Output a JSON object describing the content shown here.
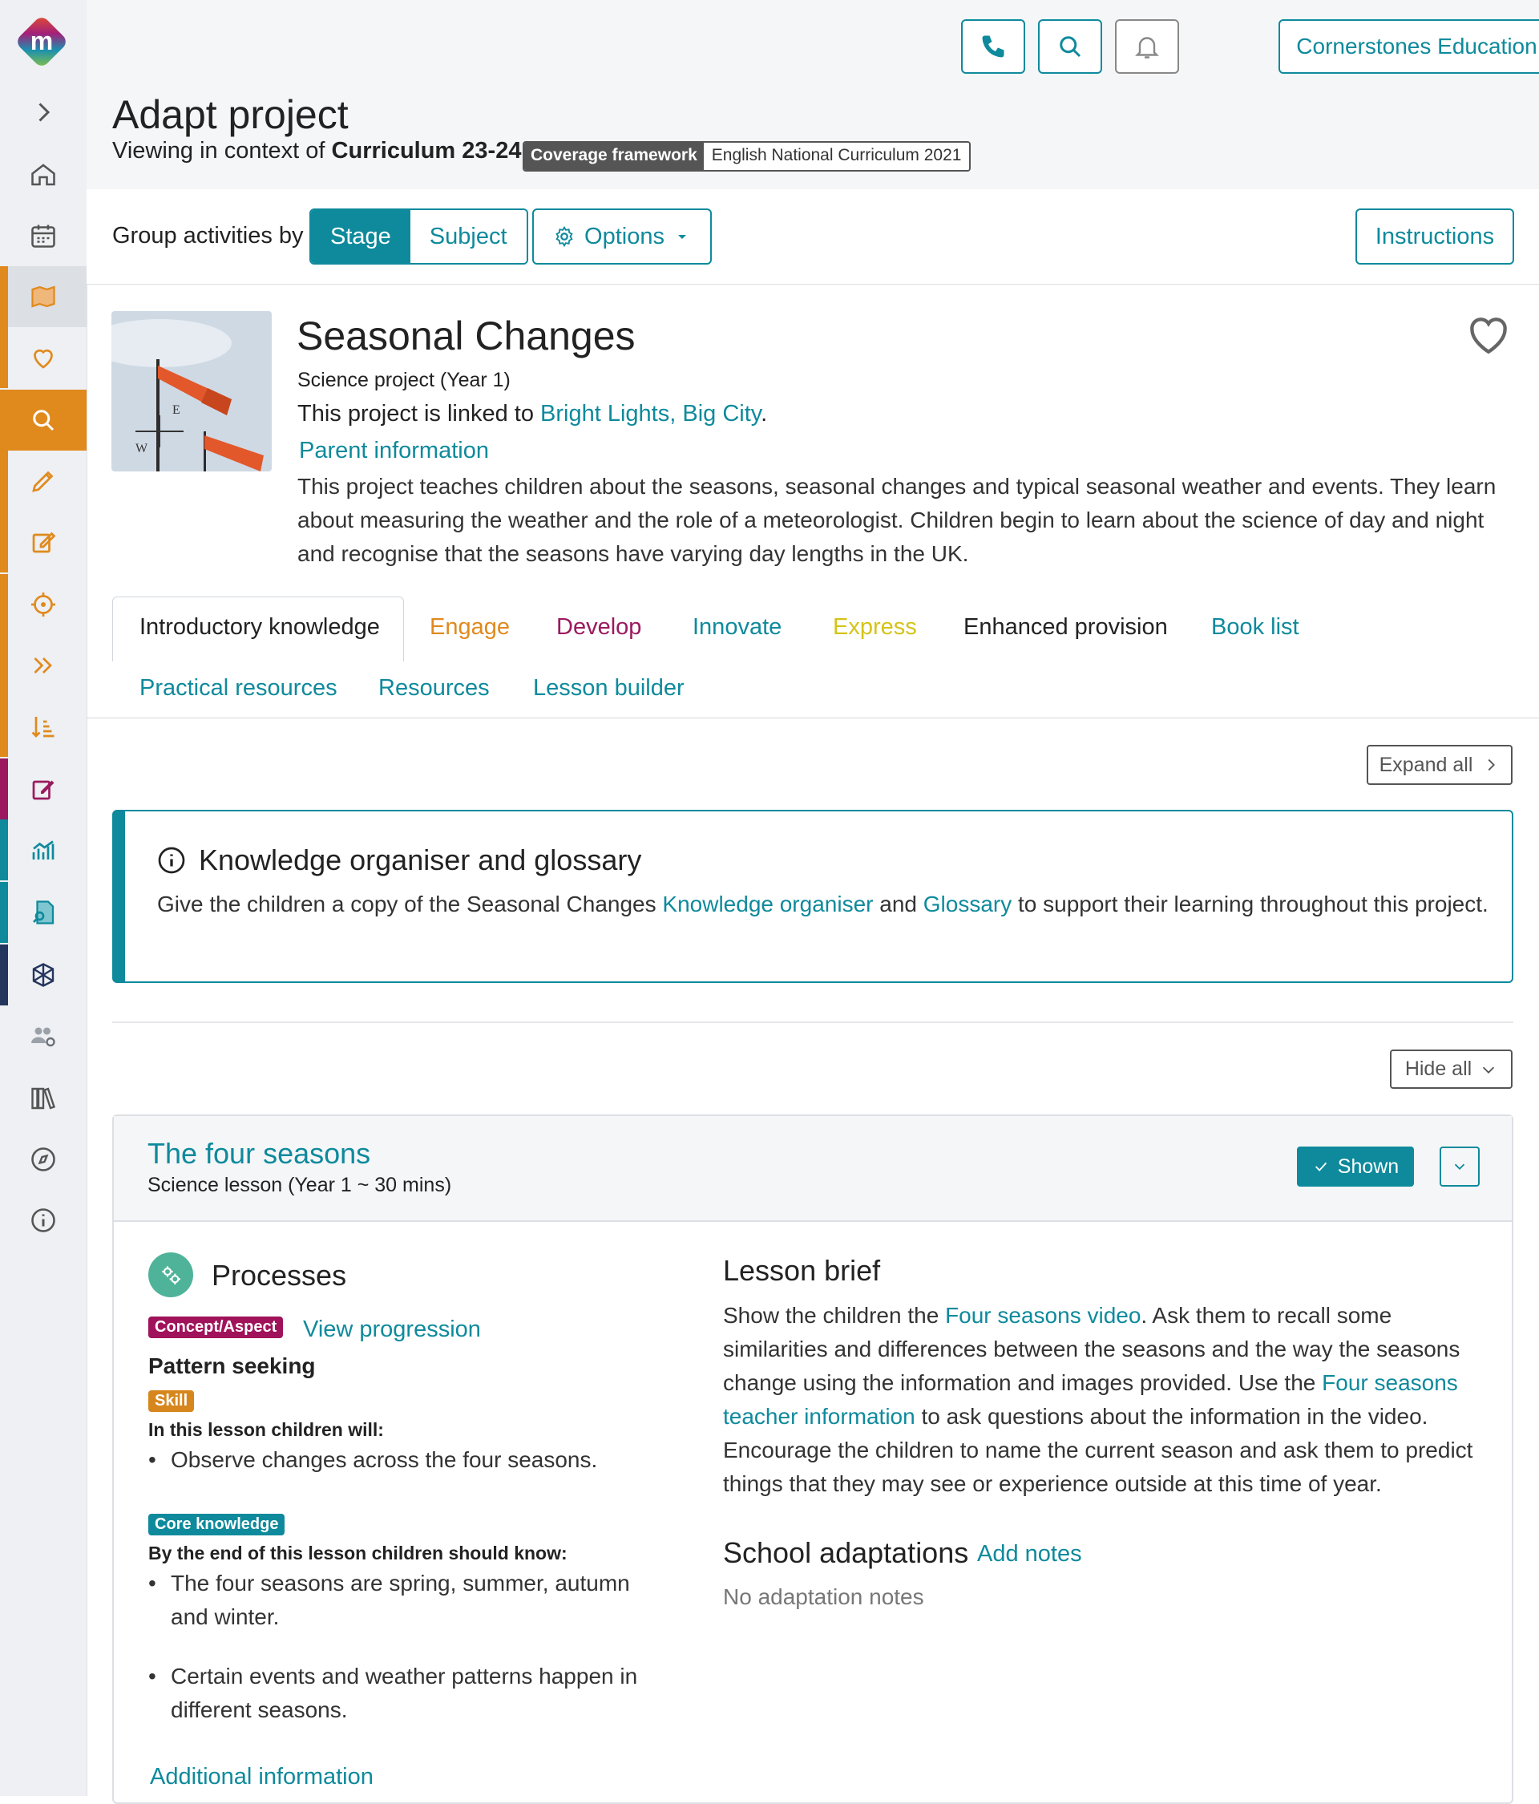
{
  "header": {
    "org_name": "Cornerstones Education",
    "page_title": "Adapt project",
    "context_prefix": "Viewing in context of",
    "context_value": "Curriculum 23-24",
    "coverage_key": "Coverage framework",
    "coverage_value": "English National Curriculum 2021"
  },
  "toolbar": {
    "group_label": "Group activities by",
    "stage": "Stage",
    "subject": "Subject",
    "options": "Options",
    "instructions": "Instructions"
  },
  "project": {
    "title": "Seasonal Changes",
    "subtitle": "Science project (Year 1)",
    "linked_prefix": "This project is linked to",
    "linked_link": "Bright Lights, Big City",
    "linked_suffix": ".",
    "parent_info": "Parent information",
    "description": "This project teaches children about the seasons, seasonal changes and typical seasonal weather and events. They learn about measuring the weather and the role of a meteorologist. Children begin to learn about the science of day and night and recognise that the seasons have varying day lengths in the UK."
  },
  "tabs": [
    {
      "label": "Introductory knowledge",
      "color": "#222222"
    },
    {
      "label": "Engage",
      "color": "#e08a1e"
    },
    {
      "label": "Develop",
      "color": "#9b1a5f"
    },
    {
      "label": "Innovate",
      "color": "#0e8a9c"
    },
    {
      "label": "Express",
      "color": "#d4c418"
    },
    {
      "label": "Enhanced provision",
      "color": "#222222"
    },
    {
      "label": "Book list",
      "color": "#0e8a9c"
    },
    {
      "label": "Practical resources",
      "color": "#0e8a9c"
    },
    {
      "label": "Resources",
      "color": "#0e8a9c"
    },
    {
      "label": "Lesson builder",
      "color": "#0e8a9c"
    }
  ],
  "content": {
    "expand_all": "Expand all",
    "hide_all": "Hide all",
    "organiser": {
      "title": "Knowledge organiser and glossary",
      "text_1": "Give the children a copy of the Seasonal Changes",
      "link_1": "Knowledge organiser",
      "text_2": "and",
      "link_2": "Glossary",
      "text_3": "to support their learning throughout this project."
    }
  },
  "lesson": {
    "title": "The four seasons",
    "subtitle": "Science lesson (Year 1 ~ 30 mins)",
    "shown": "Shown",
    "processes": "Processes",
    "concept_badge": "Concept/Aspect",
    "view_progression": "View progression",
    "pattern": "Pattern seeking",
    "skill_badge": "Skill",
    "will_label": "In this lesson children will:",
    "will_items": [
      "Observe changes across the four seasons."
    ],
    "core_badge": "Core knowledge",
    "know_label": "By the end of this lesson children should know:",
    "know_items": [
      "The four seasons are spring, summer, autumn and winter.",
      "Certain events and weather patterns happen in different seasons."
    ],
    "additional": "Additional information",
    "brief_title": "Lesson brief",
    "brief_1": "Show the children the",
    "brief_link_1": "Four seasons video",
    "brief_2": ". Ask them to recall some similarities and differences between the seasons and the way the seasons change using the information and images provided. Use the",
    "brief_link_2": "Four seasons teacher information",
    "brief_3": "to ask questions about the information in the video. Encourage the children to name the current season and ask them to predict things that they may see or experience outside at this time of year.",
    "adapt_title": "School adaptations",
    "add_notes": "Add notes",
    "no_notes": "No adaptation notes"
  },
  "icons": {
    "sidebar": [
      "expand-icon",
      "home-icon",
      "calendar-icon",
      "map-icon",
      "heart-icon",
      "search-icon",
      "pencil-ruler-icon",
      "edit-icon",
      "target-icon",
      "fast-forward-icon",
      "sort-icon",
      "edit-pink-icon",
      "chart-icon",
      "file-search-icon",
      "network-icon",
      "users-gear-icon",
      "library-icon",
      "compass-icon",
      "info-icon"
    ],
    "accent": "#0e8a9c",
    "sidebar_orange": "#e08a1e"
  }
}
